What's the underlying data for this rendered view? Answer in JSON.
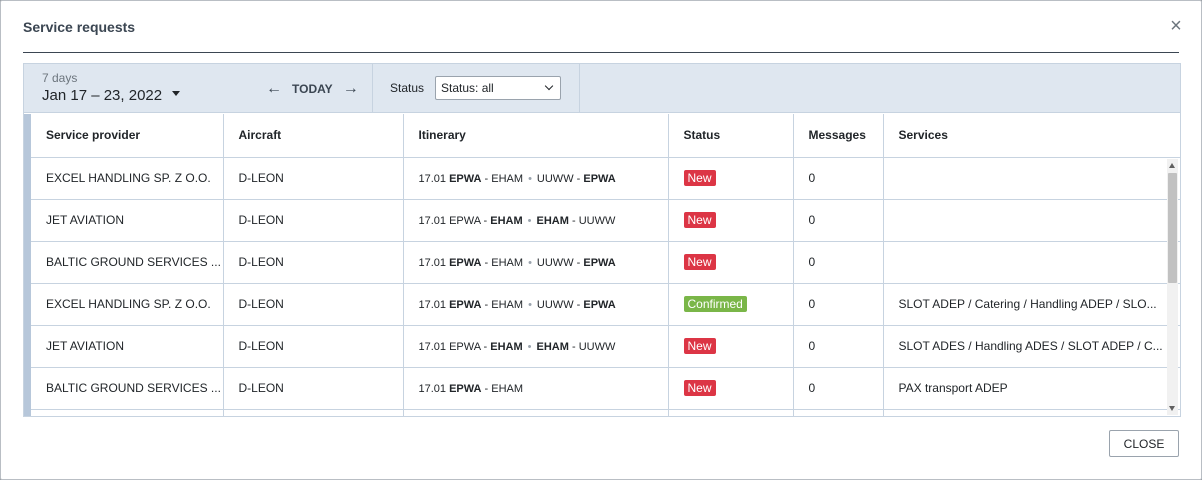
{
  "modal": {
    "title": "Service requests",
    "close_icon_glyph": "×"
  },
  "toolbar": {
    "range_caption": "7 days",
    "range_value": "Jan 17 – 23, 2022",
    "prev_icon": "←",
    "today_label": "TODAY",
    "next_icon": "→",
    "status_label": "Status",
    "status_select_value": "Status: all"
  },
  "table": {
    "columns": [
      "Service provider",
      "Aircraft",
      "Itinerary",
      "Status",
      "Messages",
      "Services"
    ],
    "rows": [
      {
        "provider": "EXCEL HANDLING SP. Z O.O.",
        "aircraft": "D-LEON",
        "itinerary": {
          "date": "17.01",
          "leg1_from": "EPWA",
          "leg1_to": "EHAM",
          "leg2_from": "UUWW",
          "leg2_to": "EPWA",
          "bold": [
            "leg1_from",
            "leg2_to"
          ]
        },
        "status": "New",
        "messages": "0",
        "services": ""
      },
      {
        "provider": "JET AVIATION",
        "aircraft": "D-LEON",
        "itinerary": {
          "date": "17.01",
          "leg1_from": "EPWA",
          "leg1_to": "EHAM",
          "leg2_from": "EHAM",
          "leg2_to": "UUWW",
          "bold": [
            "leg1_to",
            "leg2_from"
          ]
        },
        "status": "New",
        "messages": "0",
        "services": ""
      },
      {
        "provider": "BALTIC GROUND SERVICES ...",
        "aircraft": "D-LEON",
        "itinerary": {
          "date": "17.01",
          "leg1_from": "EPWA",
          "leg1_to": "EHAM",
          "leg2_from": "UUWW",
          "leg2_to": "EPWA",
          "bold": [
            "leg1_from",
            "leg2_to"
          ]
        },
        "status": "New",
        "messages": "0",
        "services": ""
      },
      {
        "provider": "EXCEL HANDLING SP. Z O.O.",
        "aircraft": "D-LEON",
        "itinerary": {
          "date": "17.01",
          "leg1_from": "EPWA",
          "leg1_to": "EHAM",
          "leg2_from": "UUWW",
          "leg2_to": "EPWA",
          "bold": [
            "leg1_from",
            "leg2_to"
          ]
        },
        "status": "Confirmed",
        "messages": "0",
        "services": "SLOT ADEP / Catering / Handling ADEP / SLO..."
      },
      {
        "provider": "JET AVIATION",
        "aircraft": "D-LEON",
        "itinerary": {
          "date": "17.01",
          "leg1_from": "EPWA",
          "leg1_to": "EHAM",
          "leg2_from": "EHAM",
          "leg2_to": "UUWW",
          "bold": [
            "leg1_to",
            "leg2_from"
          ]
        },
        "status": "New",
        "messages": "0",
        "services": "SLOT ADES / Handling ADES / SLOT ADEP / C..."
      },
      {
        "provider": "BALTIC GROUND SERVICES ...",
        "aircraft": "D-LEON",
        "itinerary": {
          "date": "17.01",
          "leg1_from": "EPWA",
          "leg1_to": "EHAM",
          "leg2_from": "",
          "leg2_to": "",
          "bold": [
            "leg1_from"
          ]
        },
        "status": "New",
        "messages": "0",
        "services": "PAX transport ADEP"
      },
      {
        "provider": "",
        "aircraft": "",
        "itinerary": {
          "date": "",
          "leg1_from": "",
          "leg1_to": "",
          "leg2_from": "",
          "leg2_to": "",
          "bold": []
        },
        "status": "",
        "messages": "",
        "services": ""
      }
    ]
  },
  "footer": {
    "close_label": "CLOSE"
  },
  "colors": {
    "status_new": "#dc3545",
    "status_confirmed": "#7ab648",
    "toolbar_bg": "#dfe7f0",
    "title_color": "#3b4652"
  }
}
